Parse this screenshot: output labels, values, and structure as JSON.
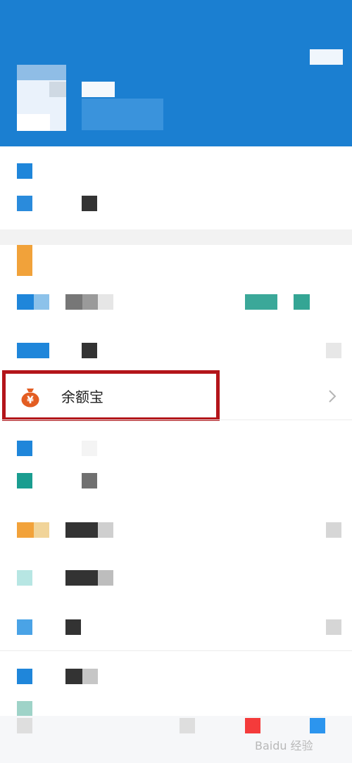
{
  "yuebao": {
    "label": "余额宝",
    "icon": "money-bag-icon",
    "accent": "#e35d22"
  },
  "highlight_color": "#b3151a",
  "header_color": "#1b7fd1",
  "watermark": "Baidu 经验"
}
